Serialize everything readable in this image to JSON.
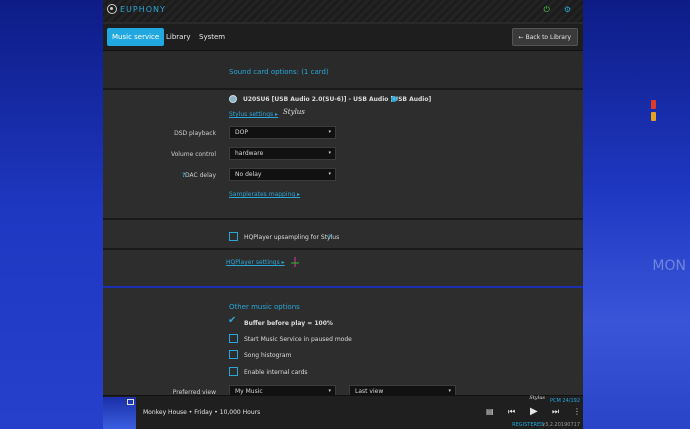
{
  "app": {
    "logo_text": "EUPHONY",
    "logo_subtext": "Stylus"
  },
  "nav": {
    "tabs": [
      {
        "label": "Music service",
        "active": true
      },
      {
        "label": "Library",
        "active": false
      },
      {
        "label": "System",
        "active": false
      }
    ],
    "back_label": "← Back to Library"
  },
  "sound": {
    "title": "Sound card options: (1 card)",
    "card_name": "U20SU6 [USB Audio 2.0(SU-6)] - USB Audio [USB Audio]",
    "stylus_settings_label": "Stylus settings ▸",
    "dsd_label": "DSD playback",
    "dsd_value": "DOP",
    "volume_label": "Volume control",
    "volume_value": "hardware",
    "dac_help": "?",
    "dac_label": "DAC delay",
    "dac_value": "No delay",
    "samplerates_label": "Samplerates mapping ▸"
  },
  "hqplayer": {
    "upsampling_label": "HQPlayer upsampling for Stylus",
    "help": "?",
    "settings_label": "HQPlayer settings ▸"
  },
  "other": {
    "title": "Other music options",
    "options": [
      {
        "label": "Buffer before play = 100%",
        "checked": true
      },
      {
        "label": "Start Music Service in paused mode",
        "checked": false
      },
      {
        "label": "Song histogram",
        "checked": false
      },
      {
        "label": "Enable internal cards",
        "checked": false
      }
    ],
    "preferred_view_label": "Preferred view",
    "preferred_view_value": "My Music",
    "last_view_value": "Last view"
  },
  "player": {
    "track": "Monkey House • Friday • 10,000 Hours",
    "format": "PCM 24/192",
    "status": "REGISTERED",
    "version": "v3.2.20190717",
    "signature": "Stylus"
  },
  "colors": {
    "accent": "#22a8e0",
    "power": "#4fd24a"
  }
}
